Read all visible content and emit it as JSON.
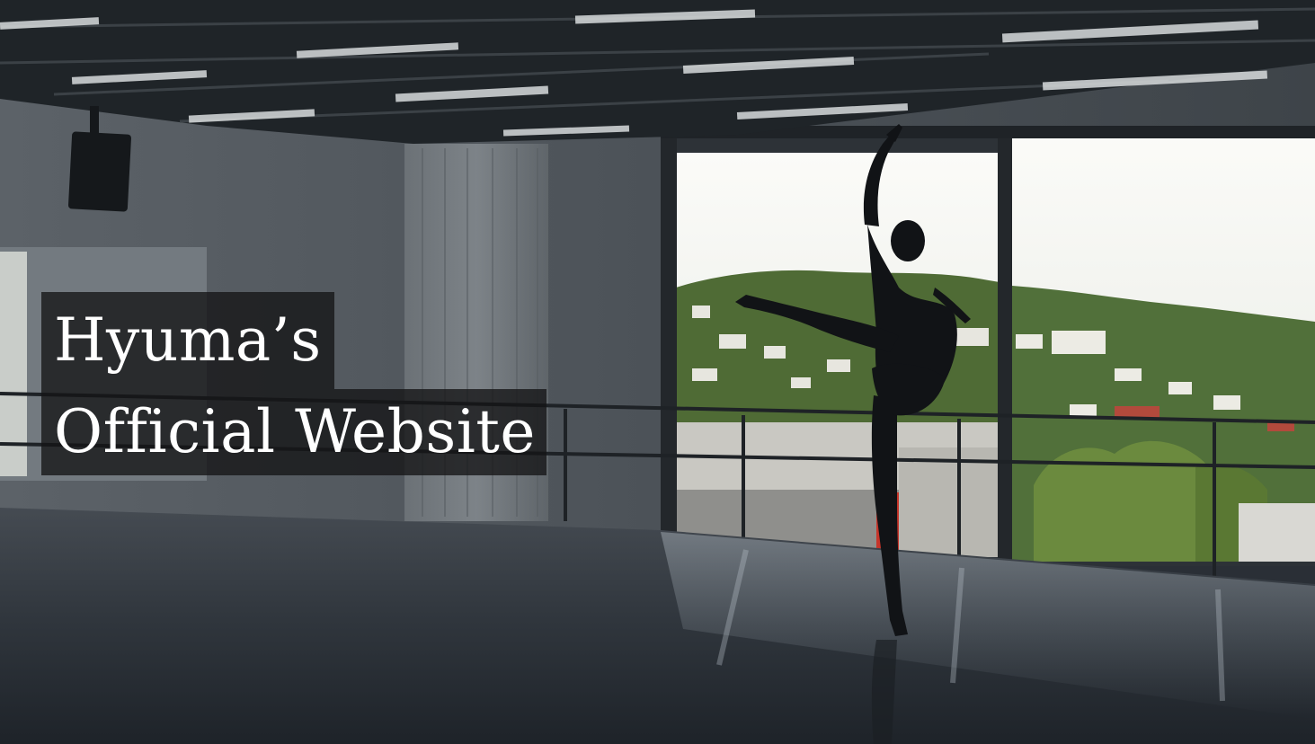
{
  "hero": {
    "title_line_1": "Hyuma’s",
    "title_line_2": "Official Website"
  },
  "background": {
    "subject": "ballet-dancer-silhouette-in-studio",
    "colors": {
      "ceiling": "#1f2428",
      "wall": "#565c62",
      "floor": "#30353c",
      "sky": "#f3f4f1",
      "hills": "#4d6b33"
    }
  }
}
